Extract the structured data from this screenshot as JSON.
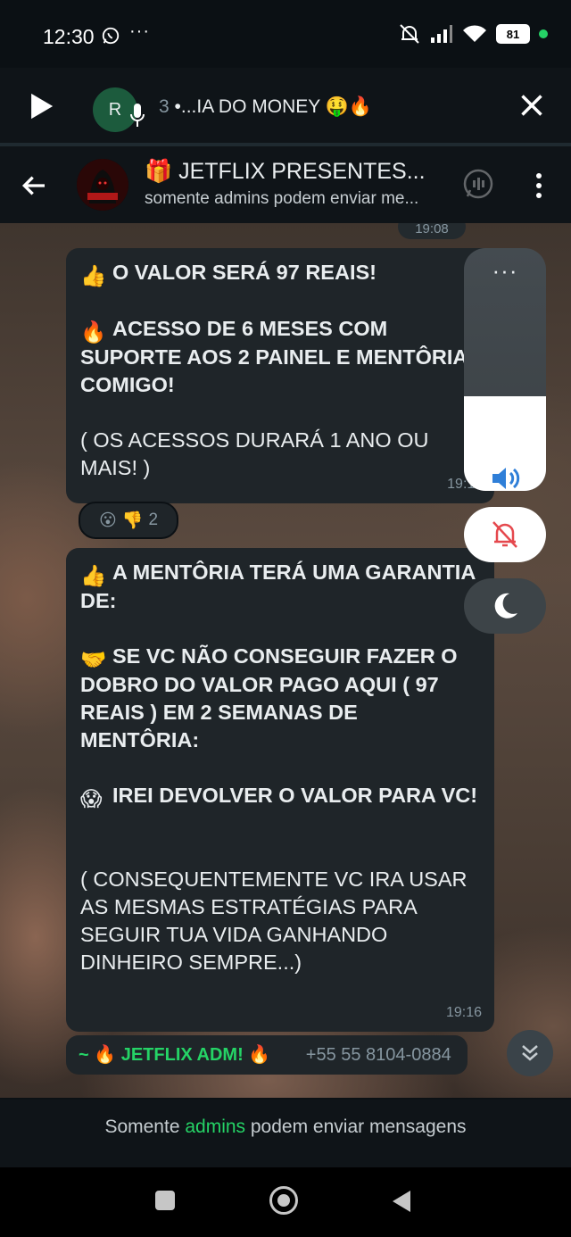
{
  "status_bar": {
    "time": "12:30",
    "dots": "···",
    "battery": "81"
  },
  "audio_player": {
    "avatar_letter": "R",
    "count": "3",
    "title": "•...IA DO MONEY 🤑🔥"
  },
  "header": {
    "title": "🎁 JETFLIX PRESENTES...",
    "subtitle": "somente admins podem enviar me..."
  },
  "messages": [
    {
      "time_top_chip": "19:08",
      "lines": [
        {
          "emoji": "👍",
          "text": "O VALOR SERÁ 97 REAIS!"
        },
        {
          "emoji": "🔥",
          "text": "ACESSO DE 6 MESES COM SUPORTE AOS 2 PAINEL E MENTÔRIA COMIGO!"
        },
        {
          "text": "( OS ACESSOS DURARÁ 1 ANO OU MAIS! )"
        }
      ],
      "time": "19:11",
      "reactions": {
        "emojis": [
          "😮",
          "👎"
        ],
        "count": "2"
      }
    },
    {
      "lines": [
        {
          "emoji": "👍",
          "text": "A MENTÔRIA TERÁ UMA GARANTIA DE:"
        },
        {
          "emoji": "🤝",
          "text": "SE VC NÃO CONSEGUIR FAZER O DOBRO DO VALOR PAGO AQUI ( 97 REAIS ) EM 2 SEMANAS DE MENTÔRIA:"
        },
        {
          "emoji": "😱",
          "text": "IREI DEVOLVER O VALOR PARA VC!"
        },
        {
          "text": "( CONSEQUENTEMENTE VC IRA USAR AS MESMAS ESTRATÉGIAS PARA SEGUIR TUA VIDA GANHANDO DINHEIRO SEMPRE...)"
        }
      ],
      "time": "19:16"
    }
  ],
  "sender": {
    "prefix": "~ 🔥",
    "name": "JETFLIX ADM! 🔥",
    "phone": "+55 55 8104-0884"
  },
  "volume_panel": {
    "dots": "···",
    "level": 0.39
  },
  "footer": {
    "before": "Somente ",
    "highlight": "admins",
    "after": " podem enviar mensagens"
  },
  "colors": {
    "accent": "#25d366",
    "bubble": "#1f2529",
    "icon_blue": "#2f7fd8",
    "icon_red": "#e5484d"
  }
}
